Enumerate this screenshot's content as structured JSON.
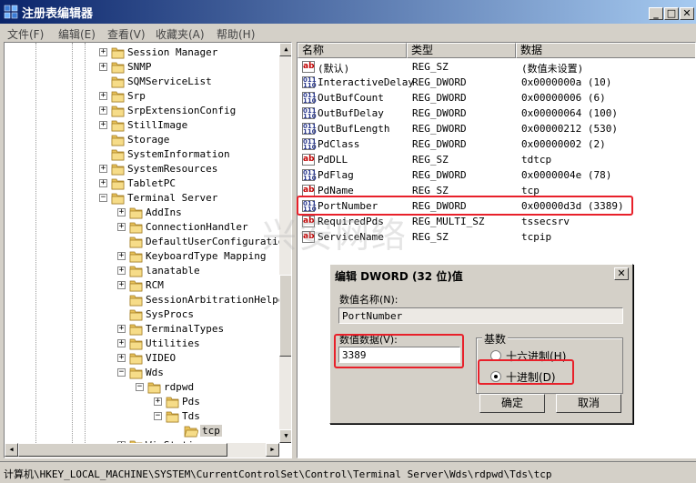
{
  "window": {
    "title": "注册表编辑器",
    "app_icon": "regedit-icon"
  },
  "menu": [
    "文件(F)",
    "编辑(E)",
    "查看(V)",
    "收藏夹(A)",
    "帮助(H)"
  ],
  "tree": {
    "items": [
      {
        "label": "Session Manager",
        "expander": "+"
      },
      {
        "label": "SNMP",
        "expander": "+"
      },
      {
        "label": "SQMServiceList",
        "expander": ""
      },
      {
        "label": "Srp",
        "expander": "+"
      },
      {
        "label": "SrpExtensionConfig",
        "expander": "+"
      },
      {
        "label": "StillImage",
        "expander": "+"
      },
      {
        "label": "Storage",
        "expander": ""
      },
      {
        "label": "SystemInformation",
        "expander": ""
      },
      {
        "label": "SystemResources",
        "expander": "+"
      },
      {
        "label": "TabletPC",
        "expander": "+"
      },
      {
        "label": "Terminal Server",
        "expander": "−"
      },
      {
        "label": "AddIns",
        "expander": "+"
      },
      {
        "label": "ConnectionHandler",
        "expander": "+"
      },
      {
        "label": "DefaultUserConfiguratio",
        "expander": ""
      },
      {
        "label": "KeyboardType Mapping",
        "expander": "+"
      },
      {
        "label": "lanatable",
        "expander": "+"
      },
      {
        "label": "RCM",
        "expander": "+"
      },
      {
        "label": "SessionArbitrationHelpe",
        "expander": ""
      },
      {
        "label": "SysProcs",
        "expander": ""
      },
      {
        "label": "TerminalTypes",
        "expander": "+"
      },
      {
        "label": "Utilities",
        "expander": "+"
      },
      {
        "label": "VIDEO",
        "expander": "+"
      },
      {
        "label": "Wds",
        "expander": "−"
      },
      {
        "label": "rdpwd",
        "expander": "−"
      },
      {
        "label": "Pds",
        "expander": "+"
      },
      {
        "label": "Tds",
        "expander": "−"
      },
      {
        "label": "tcp",
        "expander": ""
      },
      {
        "label": "WinStations",
        "expander": "+"
      }
    ]
  },
  "list": {
    "headers": [
      "名称",
      "类型",
      "数据"
    ],
    "rows": [
      {
        "name": "(默认)",
        "type": "REG_SZ",
        "data": "(数值未设置)",
        "icon": "ab"
      },
      {
        "name": "InteractiveDelay",
        "type": "REG_DWORD",
        "data": "0x0000000a (10)",
        "icon": "dw"
      },
      {
        "name": "OutBufCount",
        "type": "REG_DWORD",
        "data": "0x00000006 (6)",
        "icon": "dw"
      },
      {
        "name": "OutBufDelay",
        "type": "REG_DWORD",
        "data": "0x00000064 (100)",
        "icon": "dw"
      },
      {
        "name": "OutBufLength",
        "type": "REG_DWORD",
        "data": "0x00000212 (530)",
        "icon": "dw"
      },
      {
        "name": "PdClass",
        "type": "REG_DWORD",
        "data": "0x00000002 (2)",
        "icon": "dw"
      },
      {
        "name": "PdDLL",
        "type": "REG_SZ",
        "data": "tdtcp",
        "icon": "ab"
      },
      {
        "name": "PdFlag",
        "type": "REG_DWORD",
        "data": "0x0000004e (78)",
        "icon": "dw"
      },
      {
        "name": "PdName",
        "type": "REG_SZ",
        "data": "tcp",
        "icon": "ab"
      },
      {
        "name": "PortNumber",
        "type": "REG_DWORD",
        "data": "0x00000d3d (3389)",
        "icon": "dw"
      },
      {
        "name": "RequiredPds",
        "type": "REG_MULTI_SZ",
        "data": "tssecsrv",
        "icon": "ab"
      },
      {
        "name": "ServiceName",
        "type": "REG_SZ",
        "data": "tcpip",
        "icon": "ab"
      }
    ]
  },
  "watermark": "兴安网络",
  "dialog": {
    "title": "编辑 DWORD (32 位)值",
    "close": "✕",
    "value_name_label": "数值名称(N):",
    "value_name": "PortNumber",
    "value_data_label": "数值数据(V):",
    "value_data": "3389",
    "base_label": "基数",
    "hex_label": "十六进制(H)",
    "dec_label": "十进制(D)",
    "selected_base": "dec",
    "ok": "确定",
    "cancel": "取消"
  },
  "status": "计算机\\HKEY_LOCAL_MACHINE\\SYSTEM\\CurrentControlSet\\Control\\Terminal Server\\Wds\\rdpwd\\Tds\\tcp",
  "colors": {
    "highlight": "#e8202a",
    "title_start": "#0a246a",
    "title_end": "#a6caf0"
  }
}
